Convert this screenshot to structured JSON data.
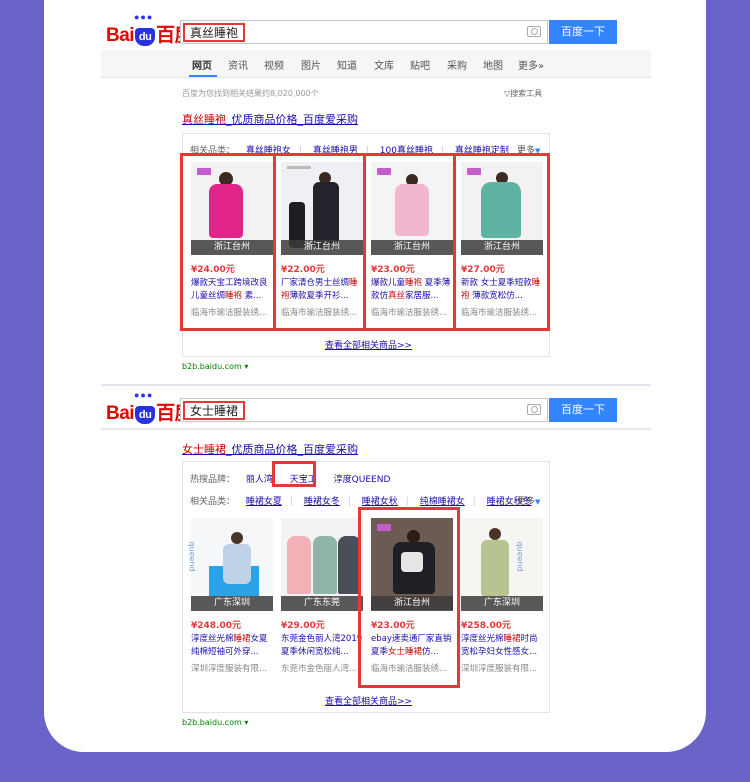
{
  "logo": {
    "bai": "Bai",
    "du": "du",
    "baidu_cn": "百度"
  },
  "search1": {
    "query": "真丝睡袍",
    "button": "百度一下"
  },
  "nav": {
    "tabs": [
      "网页",
      "资讯",
      "视频",
      "图片",
      "知道",
      "文库",
      "贴吧",
      "采购",
      "地图",
      "更多»"
    ]
  },
  "results_count": "百度为您找到相关结果约8,020,000个",
  "search_tools": "搜索工具",
  "result1": {
    "title_hl": "真丝睡袍",
    "title_rest": "_优质商品价格_百度爱采购",
    "related_label": "相关品类：",
    "related": [
      "真丝睡袍女",
      "真丝睡袍男",
      "100真丝睡袍",
      "真丝睡袍定制"
    ],
    "more": "更多",
    "products": [
      {
        "location": "浙江台州",
        "price": "¥24.00元",
        "title_a": "爆款天宝工跨境改良儿童丝绸",
        "title_hl": "睡袍",
        "title_b": " 素...",
        "shop": "临海市瑜洁服装绣..."
      },
      {
        "location": "浙江台州",
        "price": "¥22.00元",
        "title_a": "厂家清仓男士丝绸",
        "title_hl": "睡袍",
        "title_b": "薄款夏季开衫...",
        "shop": "临海市瑜洁服装绣..."
      },
      {
        "location": "浙江台州",
        "price": "¥23.00元",
        "title_a": "爆款儿童",
        "title_hl": "睡袍",
        "title_b": " 夏季薄款仿",
        "title_hl2": "真丝",
        "title_c": "家居服...",
        "shop": "临海市瑜洁服装绣..."
      },
      {
        "location": "浙江台州",
        "price": "¥27.00元",
        "title_a": "新款 女士夏季短款",
        "title_hl": "睡袍",
        "title_b": " 薄款宽松仿...",
        "shop": "临海市瑜洁服装绣..."
      }
    ],
    "view_all": "查看全部相关商品>>",
    "source": "b2b.baidu.com"
  },
  "search2": {
    "query": "女士睡裙",
    "button": "百度一下"
  },
  "result2": {
    "title_hl": "女士睡裙",
    "title_rest": "_优质商品价格_百度爱采购",
    "hot_label": "热搜品牌：",
    "hot_brands": [
      "丽人湾",
      "天宝工",
      "淳度QUEEND"
    ],
    "related_label": "相关品类：",
    "related": [
      "睡裙女夏",
      "睡裙女冬",
      "睡裙女秋",
      "纯棉睡裙女",
      "睡裙女秋冬"
    ],
    "more": "更多",
    "products": [
      {
        "location": "广东深圳",
        "price": "¥248.00元",
        "title_a": "淳度丝光棉",
        "title_hl": "睡裙",
        "title_b": "女夏纯棉短袖可外穿...",
        "shop": "深圳淳度服装有限..."
      },
      {
        "location": "广东东莞",
        "price": "¥29.00元",
        "title_a": "东莞金色丽人湾2019夏季休闲宽松纯...",
        "title_hl": "",
        "title_b": "",
        "shop": "东莞市金色丽人湾..."
      },
      {
        "location": "浙江台州",
        "price": "¥23.00元",
        "title_a": "ebay速卖通厂家直销夏季",
        "title_hl": "女士睡裙",
        "title_b": "仿...",
        "shop": "临海市瑜洁服装绣..."
      },
      {
        "location": "广东深圳",
        "price": "¥258.00元",
        "title_a": "淳度丝光棉",
        "title_hl": "睡裙",
        "title_b": "时尚宽松孕妇女性感女...",
        "shop": "深圳淳度服装有限..."
      }
    ],
    "view_all": "查看全部相关商品>>",
    "source": "b2b.baidu.com"
  },
  "watermark": "queend",
  "colors": {
    "background": "#6a64c9",
    "highlight_box": "#e53935",
    "button": "#3385ff",
    "link": "#1a0dab",
    "price": "#e4393c"
  }
}
